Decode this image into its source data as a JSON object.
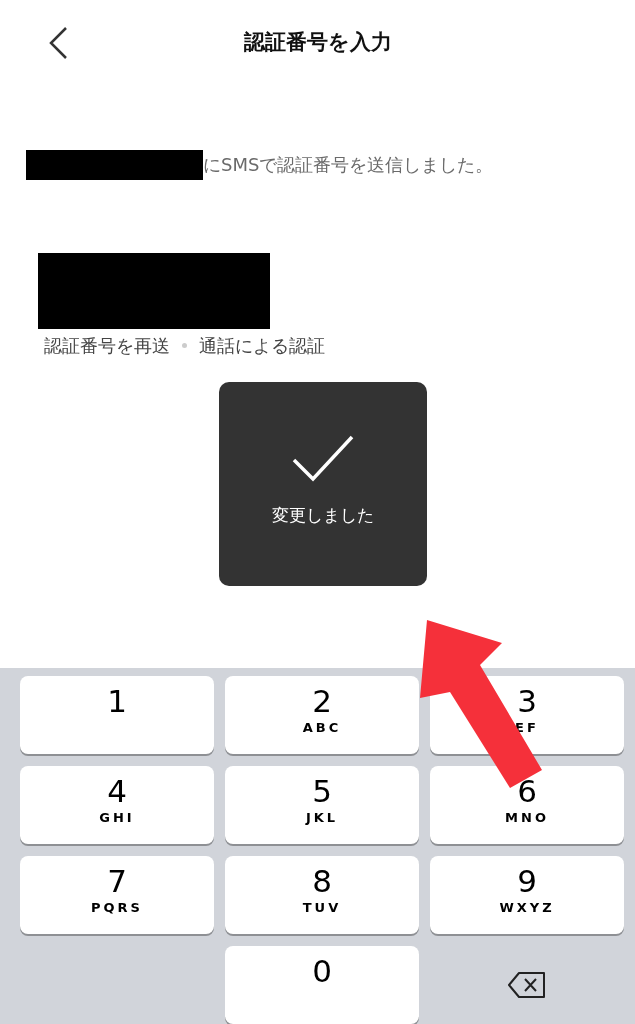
{
  "header": {
    "title": "認証番号を入力"
  },
  "message": {
    "text": "にSMSで認証番号を送信しました。"
  },
  "toast": {
    "text": "変更しました"
  },
  "links": [
    {
      "label": "認証番号を再送"
    },
    {
      "label": "通話による認証"
    }
  ],
  "keypad": {
    "rows": [
      [
        {
          "kind": "digit",
          "digit": "1"
        },
        {
          "kind": "digit",
          "digit": "2",
          "letters": "ABC"
        },
        {
          "kind": "digit",
          "digit": "3",
          "letters": "EF"
        }
      ],
      [
        {
          "kind": "digit",
          "digit": "4",
          "letters": "GHI"
        },
        {
          "kind": "digit",
          "digit": "5",
          "letters": "JKL"
        },
        {
          "kind": "digit",
          "digit": "6",
          "letters": "MNO"
        }
      ],
      [
        {
          "kind": "digit",
          "digit": "7",
          "letters": "PQRS"
        },
        {
          "kind": "digit",
          "digit": "8",
          "letters": "TUV"
        },
        {
          "kind": "digit",
          "digit": "9",
          "letters": "WXYZ"
        }
      ],
      [
        {
          "kind": "empty"
        },
        {
          "kind": "digit",
          "digit": "0"
        },
        {
          "kind": "backspace"
        }
      ]
    ]
  }
}
